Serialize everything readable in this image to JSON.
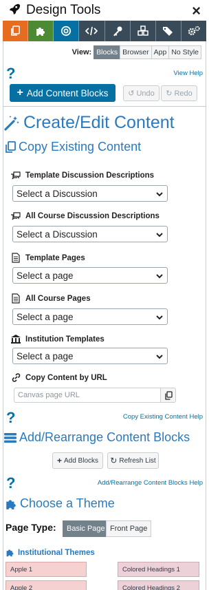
{
  "app": {
    "title": "Design Tools",
    "close_glyph": "×"
  },
  "toolbar": {
    "tabs": [
      {
        "name": "copy-icon",
        "color": "#e66c1f"
      },
      {
        "name": "puzzle-icon",
        "color": "#4d8a34"
      },
      {
        "name": "target-icon",
        "color": "#0770a3"
      },
      {
        "name": "code-icon",
        "color": "#394b58"
      },
      {
        "name": "key-icon",
        "color": "#394b58"
      },
      {
        "name": "cubes-icon",
        "color": "#394b58"
      },
      {
        "name": "tags-icon",
        "color": "#394b58"
      },
      {
        "name": "gears-icon",
        "color": "#394b58"
      }
    ]
  },
  "view": {
    "label": "View:",
    "options": [
      "Blocks",
      "Browser",
      "App",
      "No Style"
    ],
    "active": "Blocks"
  },
  "help": {
    "glyph": "?",
    "view_help": "View Help"
  },
  "actions": {
    "add_blocks": "Add Content Blocks",
    "undo": "Undo",
    "redo": "Redo"
  },
  "create": {
    "title": "Create/Edit Content"
  },
  "copy": {
    "title": "Copy Existing Content",
    "fields": [
      {
        "label": "Template Discussion Descriptions",
        "value": "Select a Discussion"
      },
      {
        "label": "All Course Discussion Descriptions",
        "value": "Select a Discussion"
      },
      {
        "label": "Template Pages",
        "value": "Select a page"
      },
      {
        "label": "All Course Pages",
        "value": "Select a page"
      },
      {
        "label": "Institution Templates",
        "value": "Select a page"
      }
    ],
    "url_label": "Copy Content by URL",
    "url_placeholder": "Canvas page URL",
    "help_link": "Copy Existing Content Help"
  },
  "rearrange": {
    "title": "Add/Rearrange Content Blocks",
    "add": "Add Blocks",
    "refresh": "Refresh List",
    "help_link": "Add/Rearrange Content Blocks Help"
  },
  "theme": {
    "title": "Choose a Theme",
    "page_type_label": "Page Type:",
    "page_types": [
      "Basic Page",
      "Front Page"
    ],
    "active_type": "Basic Page",
    "institutional_label": "Institutional Themes",
    "chips": [
      "Apple 1",
      "Colored Headings 1",
      "Apple 2",
      "Colored Headings 2"
    ]
  },
  "colors": {
    "accent": "#0770a3",
    "heading": "#2a7abf",
    "chip": "#f5d1d1"
  }
}
